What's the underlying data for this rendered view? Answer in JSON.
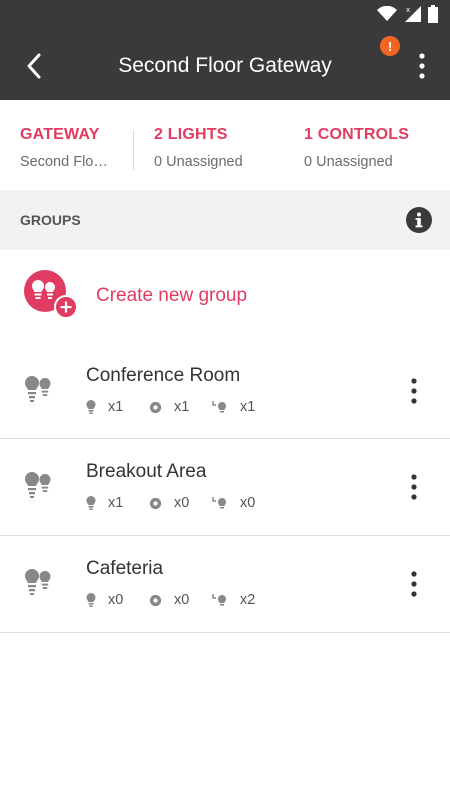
{
  "colors": {
    "accent": "#e23b62",
    "appbar": "#3a3a3c",
    "alert": "#f26522",
    "section_bg": "#f2f2f2"
  },
  "appbar": {
    "title": "Second Floor Gateway",
    "alert_badge": "!"
  },
  "summary": [
    {
      "title": "GATEWAY",
      "subtitle": "Second Flo…"
    },
    {
      "title": "2 LIGHTS",
      "subtitle": "0 Unassigned"
    },
    {
      "title": "1 CONTROLS",
      "subtitle": "0 Unassigned"
    }
  ],
  "groups_section": {
    "label": "GROUPS",
    "info_icon": "info-icon"
  },
  "create_group": {
    "label": "Create new group",
    "icon": "add-group-icon"
  },
  "groups": [
    {
      "name": "Conference Room",
      "lights": "x1",
      "controls": "x1",
      "sensors": "x1"
    },
    {
      "name": "Breakout Area",
      "lights": "x1",
      "controls": "x0",
      "sensors": "x0"
    },
    {
      "name": "Cafeteria",
      "lights": "x0",
      "controls": "x0",
      "sensors": "x2"
    }
  ]
}
